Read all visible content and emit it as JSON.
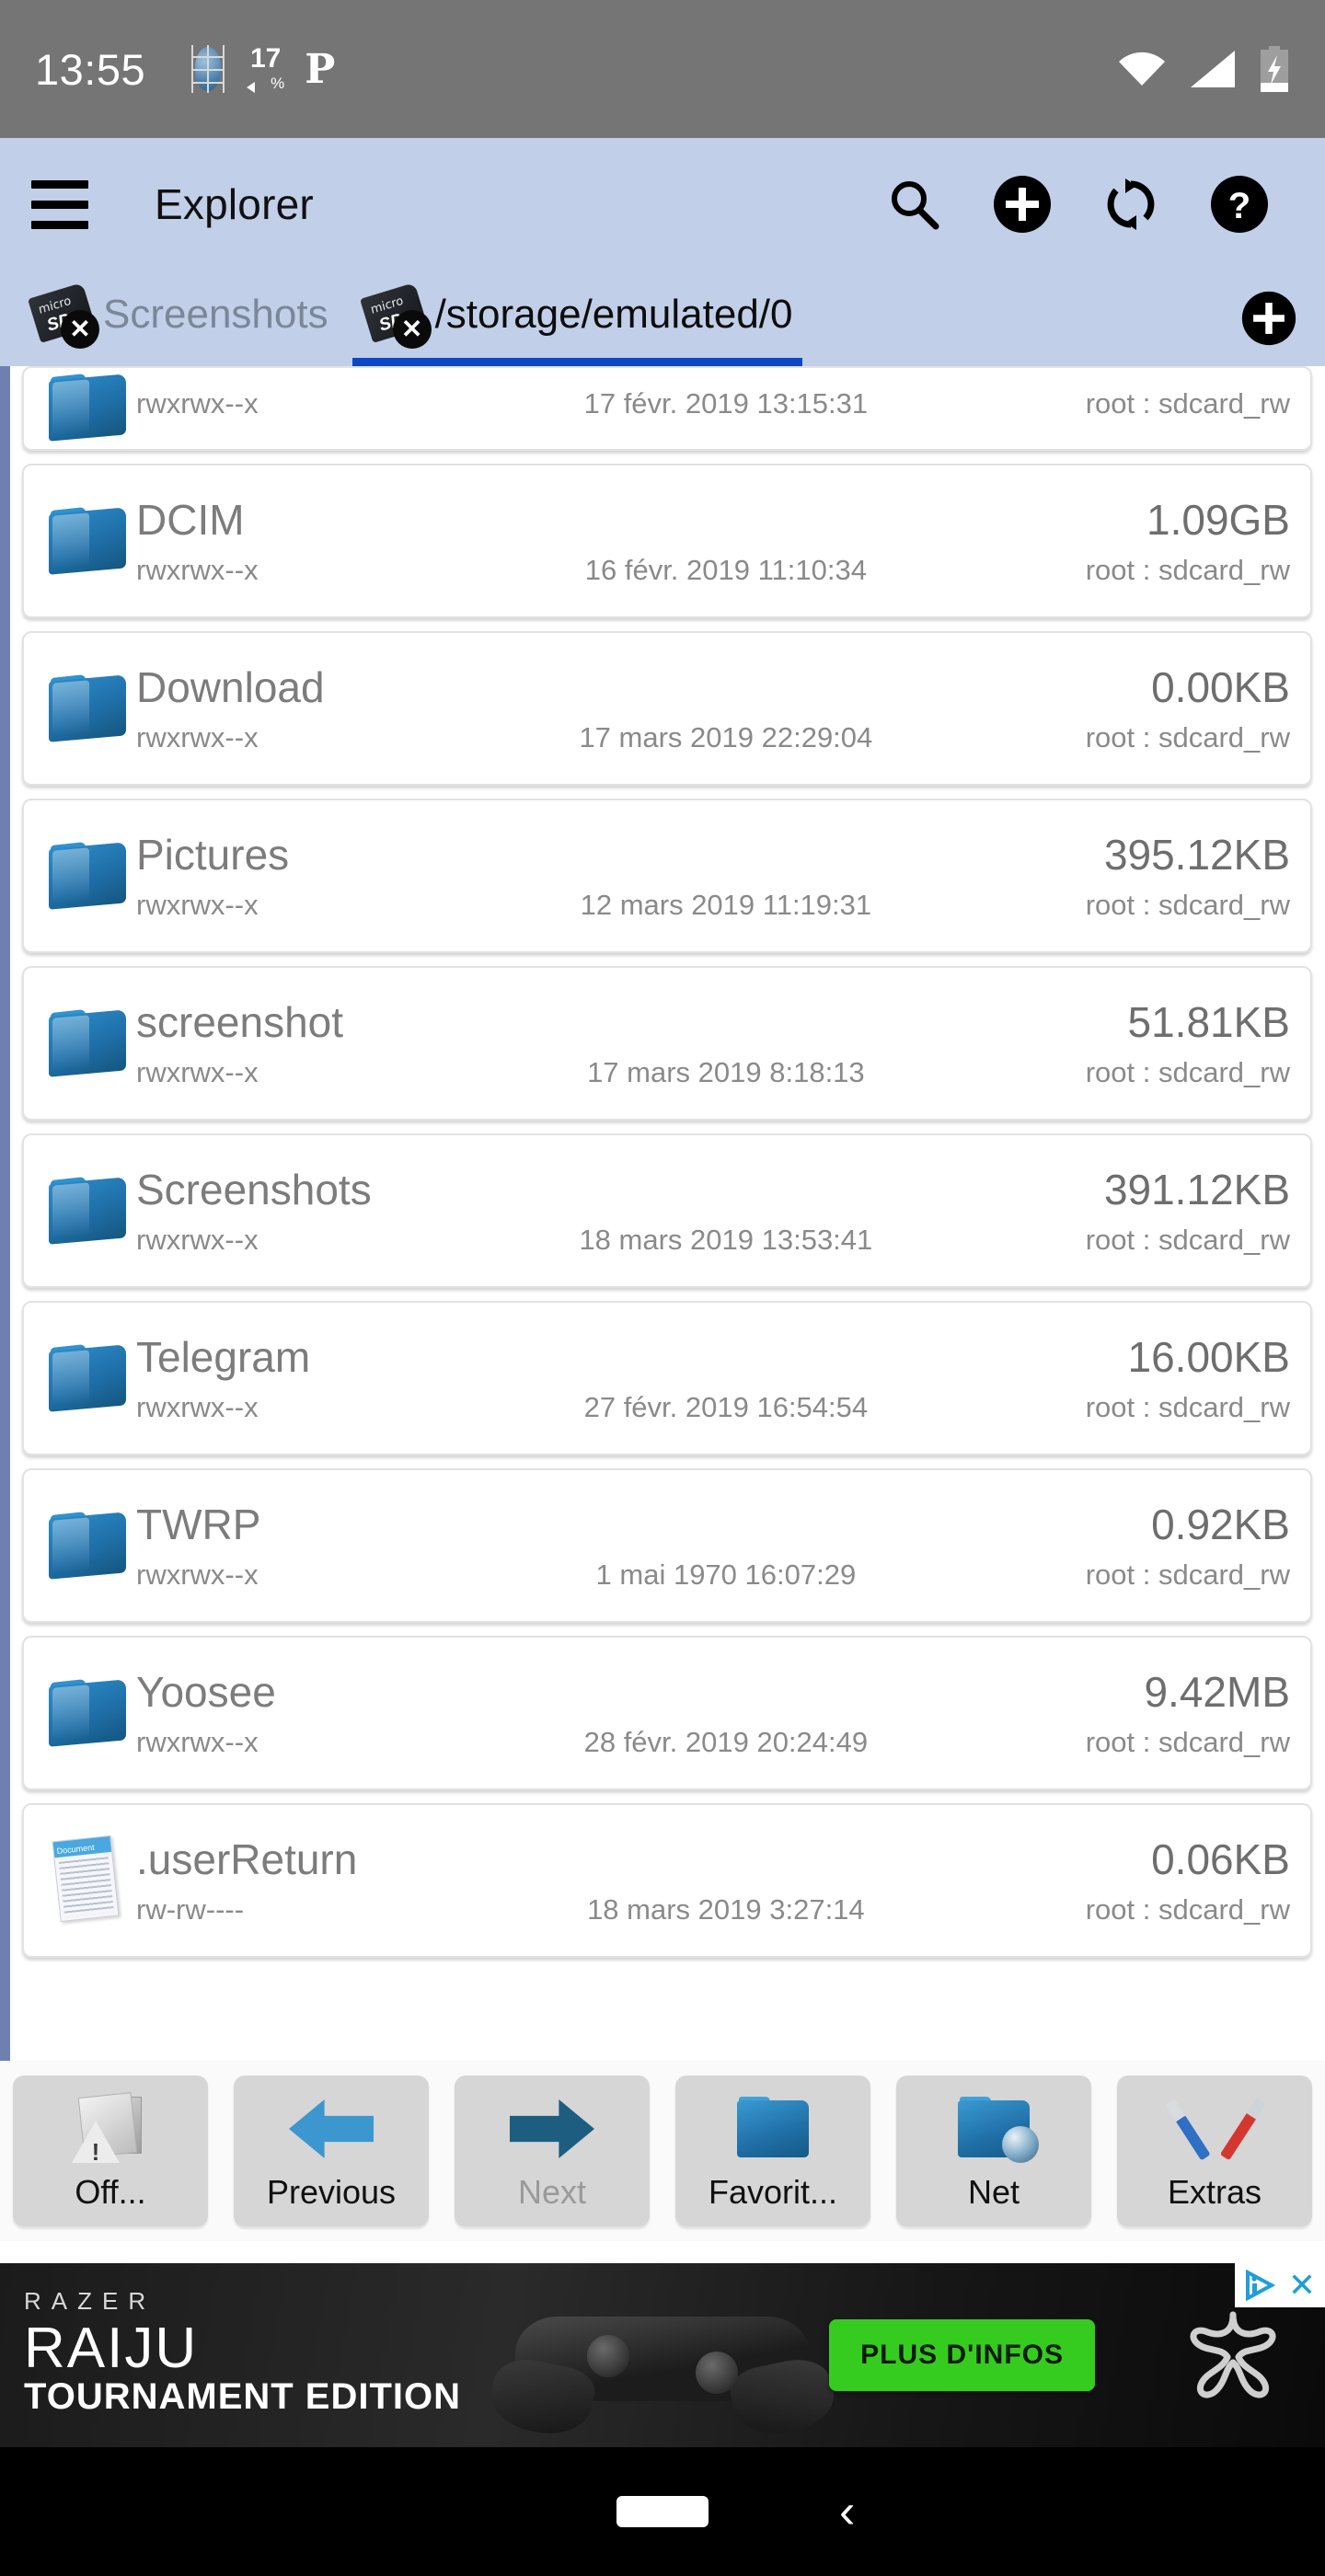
{
  "status_bar": {
    "time": "13:55",
    "battery_level": "17",
    "battery_percent_symbol": "%",
    "dual_sim_icon": "sim-globe-icon",
    "charging_icon": "plug-icon",
    "app_badge": "p-logo-icon",
    "wifi_icon": "wifi-icon",
    "signal_icon": "cellular-signal-icon",
    "battery_icon": "battery-charging-icon"
  },
  "app_bar": {
    "menu_icon": "hamburger-menu-icon",
    "title": "Explorer",
    "actions": [
      {
        "name": "search-button",
        "icon": "search-icon"
      },
      {
        "name": "add-button",
        "icon": "plus-circle-icon"
      },
      {
        "name": "refresh-button",
        "icon": "refresh-icon"
      },
      {
        "name": "help-button",
        "icon": "question-circle-icon"
      }
    ]
  },
  "tabs": {
    "items": [
      {
        "label": "Screenshots",
        "active": false,
        "icon": "microsd-card-icon",
        "close_icon": "close-icon"
      },
      {
        "label": "/storage/emulated/0",
        "active": true,
        "icon": "microsd-card-icon",
        "close_icon": "close-icon"
      }
    ],
    "add_tab_icon": "plus-circle-icon"
  },
  "file_list": {
    "clipped_row": {
      "permissions": "rwxrwx--x",
      "date": "17 févr. 2019 13:15:31",
      "owner": "root : sdcard_rw"
    },
    "rows": [
      {
        "name": "DCIM",
        "size": "1.09GB",
        "permissions": "rwxrwx--x",
        "date": "16 févr. 2019 11:10:34",
        "owner": "root : sdcard_rw",
        "type": "folder"
      },
      {
        "name": "Download",
        "size": "0.00KB",
        "permissions": "rwxrwx--x",
        "date": "17 mars 2019 22:29:04",
        "owner": "root : sdcard_rw",
        "type": "folder"
      },
      {
        "name": "Pictures",
        "size": "395.12KB",
        "permissions": "rwxrwx--x",
        "date": "12 mars 2019 11:19:31",
        "owner": "root : sdcard_rw",
        "type": "folder"
      },
      {
        "name": "screenshot",
        "size": "51.81KB",
        "permissions": "rwxrwx--x",
        "date": "17 mars 2019 8:18:13",
        "owner": "root : sdcard_rw",
        "type": "folder"
      },
      {
        "name": "Screenshots",
        "size": "391.12KB",
        "permissions": "rwxrwx--x",
        "date": "18 mars 2019 13:53:41",
        "owner": "root : sdcard_rw",
        "type": "folder"
      },
      {
        "name": "Telegram",
        "size": "16.00KB",
        "permissions": "rwxrwx--x",
        "date": "27 févr. 2019 16:54:54",
        "owner": "root : sdcard_rw",
        "type": "folder"
      },
      {
        "name": "TWRP",
        "size": "0.92KB",
        "permissions": "rwxrwx--x",
        "date": "1 mai 1970 16:07:29",
        "owner": "root : sdcard_rw",
        "type": "folder"
      },
      {
        "name": "Yoosee",
        "size": "9.42MB",
        "permissions": "rwxrwx--x",
        "date": "28 févr. 2019 20:24:49",
        "owner": "root : sdcard_rw",
        "type": "folder"
      },
      {
        "name": ".userReturn",
        "size": "0.06KB",
        "permissions": "rw-rw----",
        "date": "18 mars 2019 3:27:14",
        "owner": "root : sdcard_rw",
        "type": "document"
      }
    ]
  },
  "toolbar": {
    "buttons": [
      {
        "label": "Off...",
        "icon": "offline-files-warning-icon",
        "disabled": false
      },
      {
        "label": "Previous",
        "icon": "arrow-left-icon",
        "disabled": false
      },
      {
        "label": "Next",
        "icon": "arrow-right-icon",
        "disabled": true
      },
      {
        "label": "Favorit...",
        "icon": "folder-icon",
        "disabled": false
      },
      {
        "label": "Net",
        "icon": "network-folder-icon",
        "disabled": false
      },
      {
        "label": "Extras",
        "icon": "tools-icon",
        "disabled": false
      }
    ]
  },
  "advertisement": {
    "brand": "RAZER",
    "title": "RAIJU",
    "subtitle": "TOURNAMENT EDITION",
    "cta_label": "PLUS D'INFOS",
    "adchoices_icon": "adchoices-icon",
    "close_icon": "close-icon",
    "logo_icon": "razer-logo-icon",
    "product_icon": "gamepad-icon"
  },
  "nav_bar": {
    "home_icon": "home-pill-icon",
    "back_icon": "back-chevron-icon"
  },
  "colors": {
    "app_bar": "#c1cfe8",
    "status_bar": "#757575",
    "tab_indicator": "#0d47c8",
    "folder_blue": "#1f6fa8",
    "cta_green": "#35cc1f",
    "scrollbar": "#6f7fb0"
  }
}
